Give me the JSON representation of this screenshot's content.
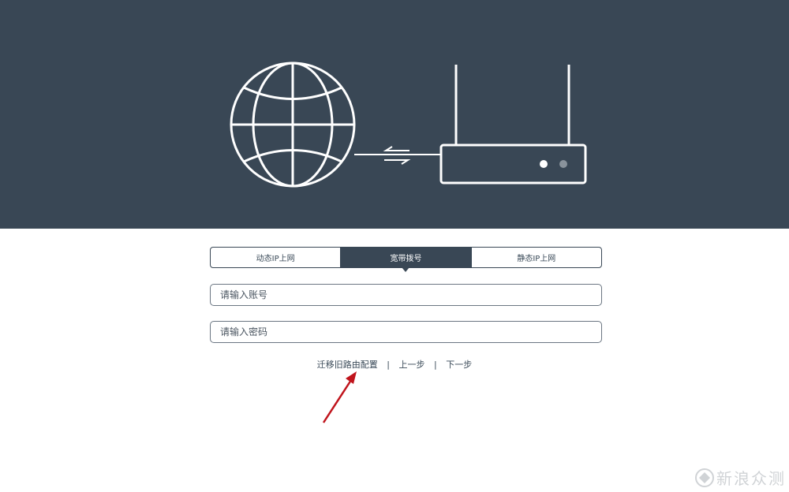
{
  "tabs": [
    {
      "label": "动态IP上网",
      "active": false
    },
    {
      "label": "宽带拨号",
      "active": true
    },
    {
      "label": "静态IP上网",
      "active": false
    }
  ],
  "account": {
    "placeholder": "请输入账号",
    "value": ""
  },
  "password": {
    "placeholder": "请输入密码",
    "value": ""
  },
  "links": {
    "migrate": "迁移旧路由配置",
    "separator": "|",
    "prev": "上一步",
    "next": "下一步"
  },
  "watermark": {
    "text": "新浪众测"
  },
  "colors": {
    "header_bg": "#394755",
    "annotation_arrow": "#c0141c"
  },
  "icons": {
    "hero_globe": "globe-icon",
    "hero_router": "router-icon",
    "hero_arrows": "exchange-arrows-icon"
  }
}
